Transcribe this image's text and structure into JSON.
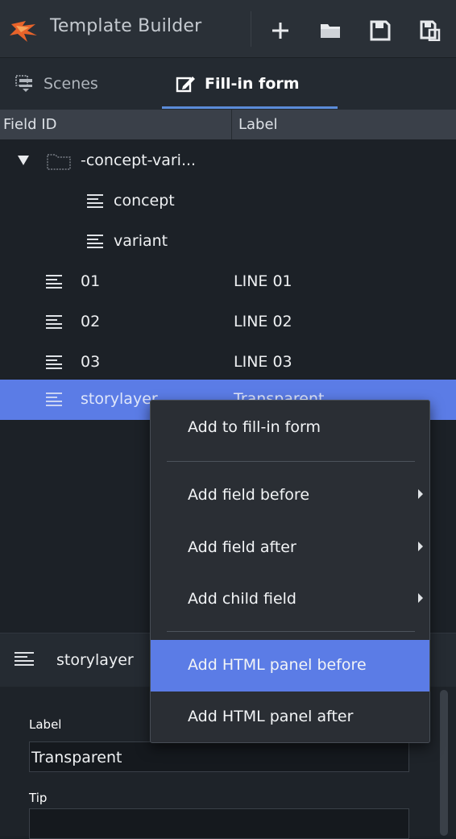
{
  "app": {
    "title": "Template Builder"
  },
  "toolbar": {
    "buttons": [
      {
        "icon": "plus-icon"
      },
      {
        "icon": "folder-icon"
      },
      {
        "icon": "save-icon"
      },
      {
        "icon": "save-as-icon"
      }
    ]
  },
  "tabs": [
    {
      "label": "Scenes",
      "icon": "scenes-icon",
      "active": false
    },
    {
      "label": "Fill-in form",
      "icon": "edit-form-icon",
      "active": true
    }
  ],
  "columns": {
    "field_id": "Field ID",
    "label": "Label"
  },
  "tree": {
    "group": {
      "id": "-concept-vari...",
      "expanded": true
    },
    "children": [
      {
        "id": "concept",
        "label": ""
      },
      {
        "id": "variant",
        "label": ""
      }
    ],
    "rows": [
      {
        "id": "01",
        "label": "LINE 01"
      },
      {
        "id": "02",
        "label": "LINE 02"
      },
      {
        "id": "03",
        "label": "LINE 03"
      },
      {
        "id": "storylayer",
        "label": "Transparent",
        "selected": true
      }
    ]
  },
  "context_menu": {
    "items": [
      {
        "label": "Add to fill-in form",
        "submenu": false
      },
      {
        "label": "Add field before",
        "submenu": true
      },
      {
        "label": "Add field after",
        "submenu": true
      },
      {
        "label": "Add child field",
        "submenu": true
      },
      {
        "label": "Add HTML panel before",
        "submenu": false,
        "highlighted": true
      },
      {
        "label": "Add HTML panel after",
        "submenu": false
      }
    ]
  },
  "detail": {
    "title": "storylayer",
    "label_caption": "Label",
    "label_value": "Transparent",
    "tip_caption": "Tip",
    "tip_value": ""
  },
  "colors": {
    "accent": "#5b7ce6",
    "tab_underline": "#5b8cd9",
    "logo": "#e8632a"
  }
}
